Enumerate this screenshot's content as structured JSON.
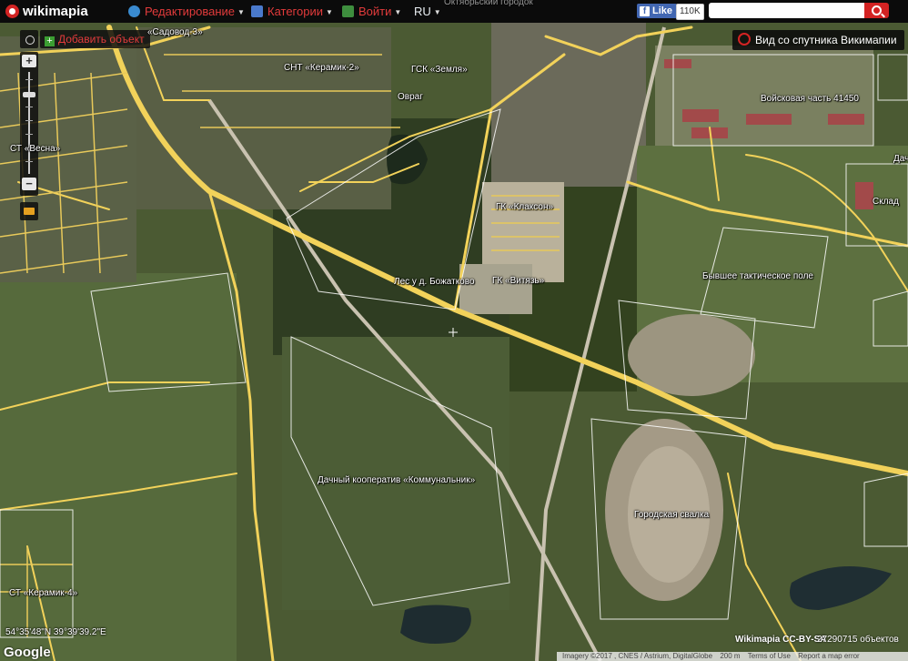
{
  "topbar": {
    "logo": "wikimapia",
    "menu_edit": "Редактирование",
    "menu_categories": "Категории",
    "menu_login": "Войти",
    "lang": "RU",
    "fb_like": "Like",
    "fb_count": "110K",
    "search_value": ""
  },
  "controls": {
    "add_object": "Добавить объект",
    "zoom_in": "+",
    "zoom_out": "−",
    "satellite_toggle": "Вид со спутника Викимапии"
  },
  "labels": {
    "oktyabrsky": "Октябрьский городок",
    "sadovod3": "«Садовод-3»",
    "snt_keramik2": "СНТ «Керамик-2»",
    "gsk_zemlya": "ГСК «Земля»",
    "ovrag": "Овраг",
    "st_vesna": "СТ «Весна»",
    "voinskaya": "Войсковая часть 41450",
    "sklad": "Склад",
    "dacha": "Дач",
    "gk_klakson": "ГК «Клаксон»",
    "les": "Лес у д. Божатково",
    "gk_vityaz": "ГК «Витязь»",
    "taktich": "Бывшее тактическое поле",
    "dachny": "Дачный кооператив «Коммунальник»",
    "svalka": "Городская свалка",
    "st_keramik4": "СТ «Керамик-4»"
  },
  "footer": {
    "coords": "54°35'48\"N 39°39'39.2\"E",
    "google": "Google",
    "license": "Wikimapia CC-BY-SA",
    "objects": "27290715 объектов",
    "imagery": "Imagery ©2017 , CNES / Astrium, DigitalGlobe",
    "scale": "200 m",
    "terms": "Terms of Use",
    "report": "Report a map error"
  },
  "colors": {
    "accent": "#d32323",
    "road": "#f2d25a",
    "topbar": "#0b0b0b"
  },
  "icons": {
    "logo": "wikimapia-pin-icon",
    "edit": "globe-icon",
    "categories": "flag-icon",
    "login": "world-icon",
    "search": "search-icon",
    "settings": "gear-icon",
    "layers": "layers-icon"
  }
}
